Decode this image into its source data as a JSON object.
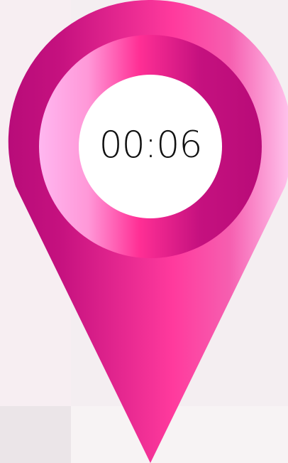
{
  "timer": {
    "display": "00:06"
  },
  "colors": {
    "pin_dark": "#b80c79",
    "pin_mid": "#f52f96",
    "pin_light": "#ffc2ef",
    "center_fill": "#ffffff",
    "text": "#111111"
  },
  "icons": {
    "marker": "map-pin-icon"
  }
}
